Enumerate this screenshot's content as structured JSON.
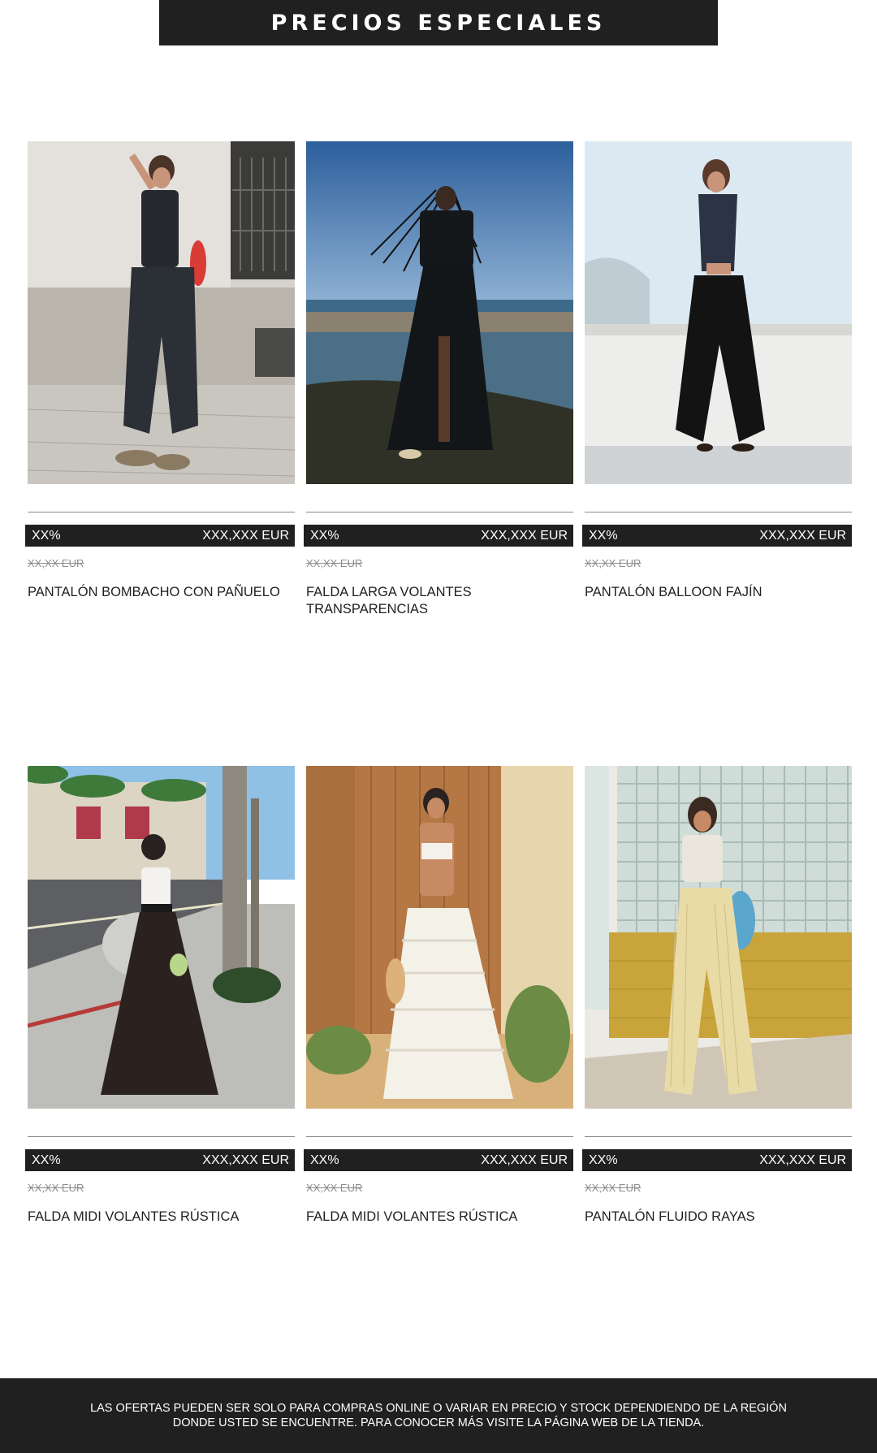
{
  "banner": {
    "title": "PRECIOS ESPECIALES"
  },
  "products": [
    {
      "discount": "XX%",
      "price": "XXX,XXX EUR",
      "old_price": "XX,XX EUR",
      "name": "PANTALÓN BOMBACHO CON PAÑUELO",
      "image": "model-black-check-pants-street"
    },
    {
      "discount": "XX%",
      "price": "XXX,XXX EUR",
      "old_price": "XX,XX EUR",
      "name": "FALDA LARGA VOLANTES TRANSPARENCIAS",
      "image": "model-black-skirt-seashore"
    },
    {
      "discount": "XX%",
      "price": "XXX,XXX EUR",
      "old_price": "XX,XX EUR",
      "name": "PANTALÓN BALLOON FAJÍN",
      "image": "model-black-balloon-pants-wall"
    },
    {
      "discount": "XX%",
      "price": "XXX,XXX EUR",
      "old_price": "XX,XX EUR",
      "name": "FALDA MIDI VOLANTES RÚSTICA",
      "image": "model-brown-ruffle-skirt-palm-street"
    },
    {
      "discount": "XX%",
      "price": "XXX,XXX EUR",
      "old_price": "XX,XX EUR",
      "name": "FALDA MIDI VOLANTES RÚSTICA",
      "image": "model-white-ruffle-skirt-wooden-door"
    },
    {
      "discount": "XX%",
      "price": "XXX,XXX EUR",
      "old_price": "XX,XX EUR",
      "name": "PANTALÓN FLUIDO RAYAS",
      "image": "model-striped-pants-glass-block-wall"
    }
  ],
  "footer": {
    "notice": "LAS OFERTAS PUEDEN SER SOLO PARA COMPRAS ONLINE O VARIAR EN PRECIO Y STOCK DEPENDIENDO DE LA REGIÓN DONDE USTED SE ENCUENTRE. PARA CONOCER MÁS VISITE LA PÁGINA WEB DE LA TIENDA."
  },
  "colors": {
    "dark": "#202020",
    "text": "#1f1f1f",
    "muted": "#8c8c8c"
  }
}
